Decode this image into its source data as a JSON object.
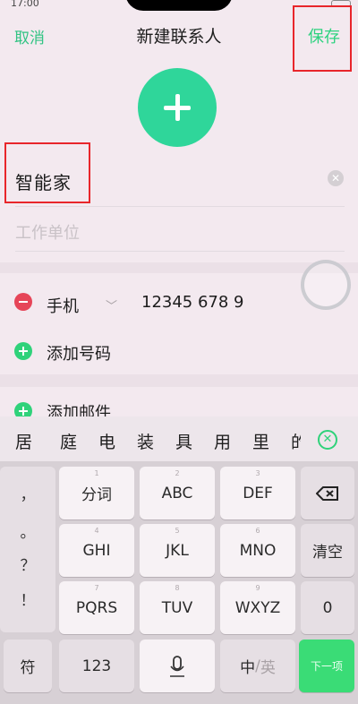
{
  "status_bar": {
    "time": "17:00"
  },
  "top_bar": {
    "cancel": "取消",
    "title": "新建联系人",
    "save": "保存"
  },
  "avatar": {
    "icon": "plus-icon",
    "color": "#2fd69a"
  },
  "form": {
    "name_value": "智能家",
    "company_placeholder": "工作单位",
    "phone_type": "手机",
    "phone_number": "12345 678 9",
    "add_phone": "添加号码",
    "add_email": "添加邮件"
  },
  "keyboard": {
    "candidates": [
      "居",
      "庭",
      "电",
      "装",
      "具",
      "用",
      "里",
      "的"
    ],
    "punctuation": [
      "，",
      "。",
      "？",
      "！"
    ],
    "row1": [
      {
        "label": "分词",
        "sup": "1"
      },
      {
        "label": "ABC",
        "sup": "2"
      },
      {
        "label": "DEF",
        "sup": "3"
      }
    ],
    "row2": [
      {
        "label": "GHI",
        "sup": "4"
      },
      {
        "label": "JKL",
        "sup": "5"
      },
      {
        "label": "MNO",
        "sup": "6"
      }
    ],
    "row3": [
      {
        "label": "PQRS",
        "sup": "7"
      },
      {
        "label": "TUV",
        "sup": "8"
      },
      {
        "label": "WXYZ",
        "sup": "9"
      }
    ],
    "clear_label": "清空",
    "zero_label": "0",
    "symbol_label": "符",
    "num_label": "123",
    "lang_zh": "中",
    "lang_sep": "/",
    "lang_en": "英",
    "next_label": "下一项"
  },
  "colors": {
    "accent_green": "#2dd27f",
    "highlight_red": "#e8262b",
    "remove_red": "#e64558"
  }
}
